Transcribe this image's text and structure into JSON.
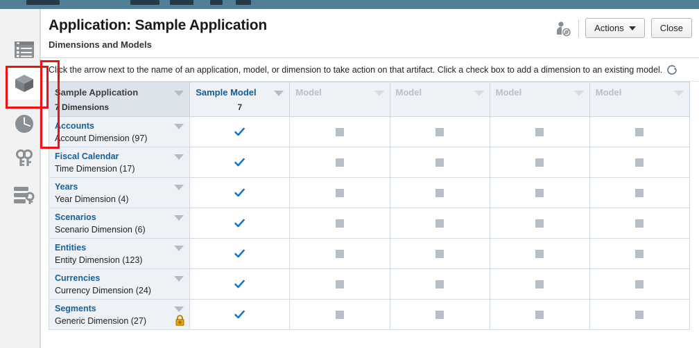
{
  "topbar": {
    "color": "#517f96"
  },
  "sidebar": {
    "items": [
      {
        "name": "list-form-icon",
        "icon": "list-form-icon",
        "selected": false
      },
      {
        "name": "cube-icon",
        "icon": "cube-icon",
        "selected": true
      },
      {
        "name": "clock-icon",
        "icon": "clock-icon",
        "selected": false
      },
      {
        "name": "keys-icon",
        "icon": "keys-icon",
        "selected": false
      },
      {
        "name": "database-key-icon",
        "icon": "database-key-icon",
        "selected": false
      }
    ]
  },
  "header": {
    "title": "Application: Sample Application",
    "subtitle": "Dimensions and Models",
    "user_icon": "user-badge-icon",
    "actions_label": "Actions",
    "close_label": "Close"
  },
  "instruction": {
    "text": "Click the arrow next to the name of an application, model, or dimension to take action on that artifact. Click a check box to add a dimension to an existing model.",
    "refresh_icon": "refresh-icon"
  },
  "table": {
    "app_column": {
      "name": "Sample Application",
      "count_label": "7  Dimensions"
    },
    "model_columns": [
      {
        "name": "Sample Model",
        "count": "7",
        "active": true,
        "placeholder": false
      },
      {
        "name": "Model",
        "count": "",
        "active": false,
        "placeholder": true
      },
      {
        "name": "Model",
        "count": "",
        "active": false,
        "placeholder": true
      },
      {
        "name": "Model",
        "count": "",
        "active": false,
        "placeholder": true
      },
      {
        "name": "Model",
        "count": "",
        "active": false,
        "placeholder": true
      }
    ],
    "rows": [
      {
        "name": "Accounts",
        "type": "Account Dimension  (97)",
        "locked": false,
        "checks": [
          "check",
          "box",
          "box",
          "box",
          "box"
        ]
      },
      {
        "name": "Fiscal Calendar",
        "type": "Time Dimension  (17)",
        "locked": false,
        "checks": [
          "check",
          "box",
          "box",
          "box",
          "box"
        ]
      },
      {
        "name": "Years",
        "type": "Year Dimension  (4)",
        "locked": false,
        "checks": [
          "check",
          "box",
          "box",
          "box",
          "box"
        ]
      },
      {
        "name": "Scenarios",
        "type": "Scenario Dimension  (6)",
        "locked": false,
        "checks": [
          "check",
          "box",
          "box",
          "box",
          "box"
        ]
      },
      {
        "name": "Entities",
        "type": "Entity Dimension  (123)",
        "locked": false,
        "checks": [
          "check",
          "box",
          "box",
          "box",
          "box"
        ]
      },
      {
        "name": "Currencies",
        "type": "Currency Dimension  (24)",
        "locked": false,
        "checks": [
          "check",
          "box",
          "box",
          "box",
          "box"
        ]
      },
      {
        "name": "Segments",
        "type": "Generic Dimension  (27)",
        "locked": true,
        "checks": [
          "check",
          "box",
          "box",
          "box",
          "box"
        ]
      }
    ]
  },
  "colors": {
    "accent_blue": "#16609e",
    "check_blue": "#1a73c4",
    "lock_gold": "#e8a400",
    "annotation_red": "#ee1111",
    "header_bg": "#eef1f5",
    "dim_header_bg": "#dde3ea"
  }
}
